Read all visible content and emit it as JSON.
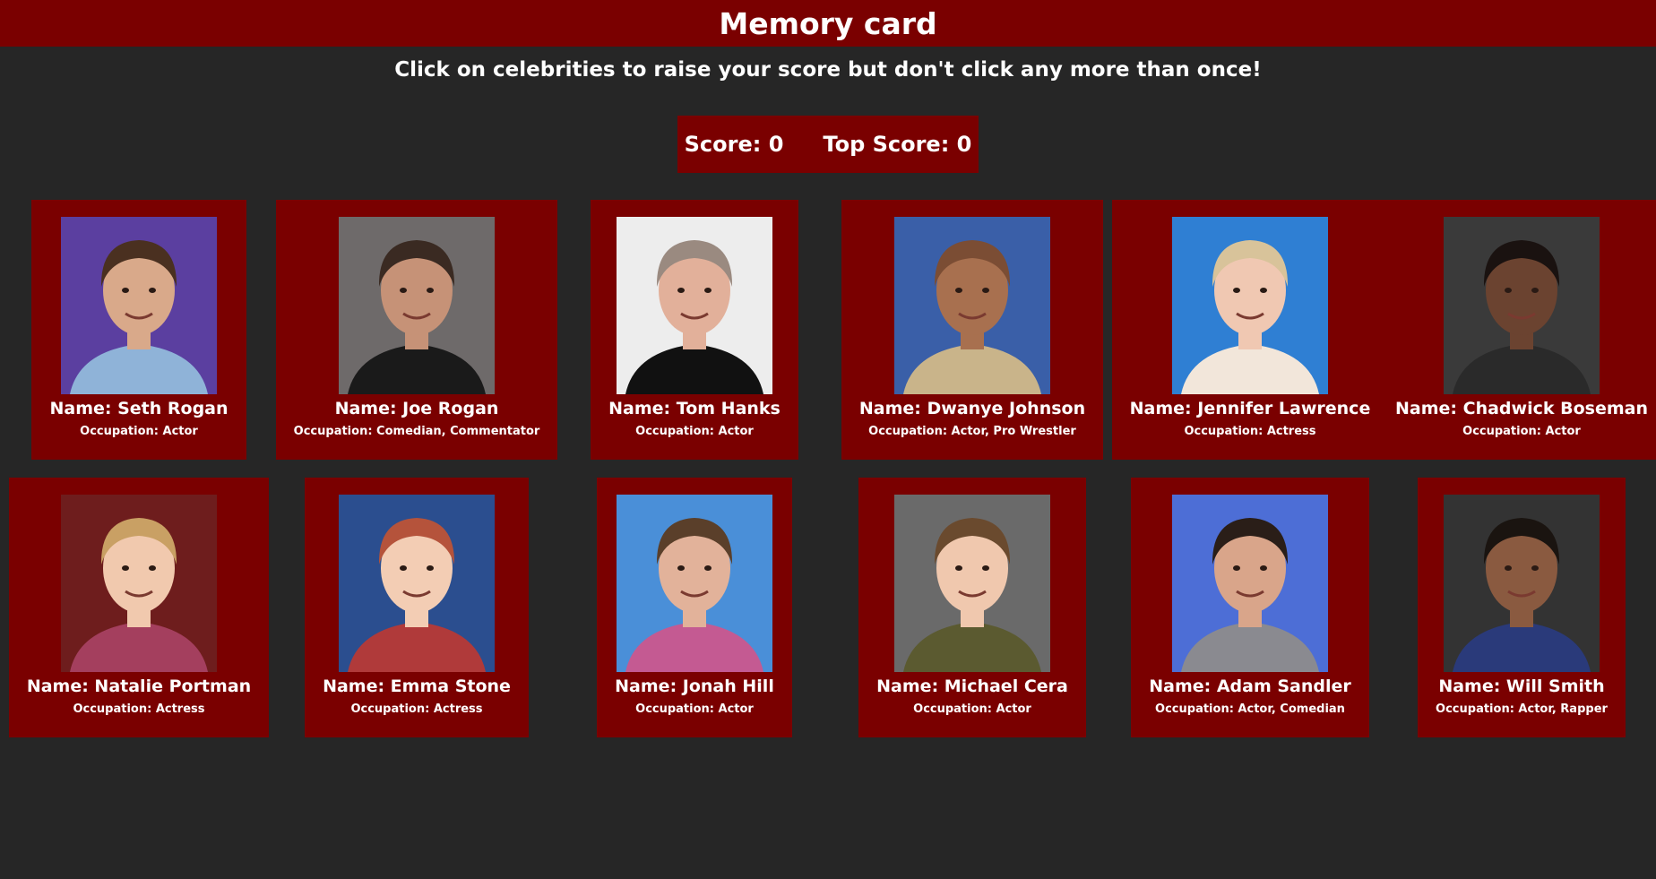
{
  "header": {
    "title": "Memory card"
  },
  "subtitle": "Click on celebrities to raise your score but don't click any more than once!",
  "score": {
    "current": "Score: 0",
    "top": "Top Score: 0",
    "current_value": 0,
    "top_value": 0
  },
  "colors": {
    "background": "#262626",
    "accent": "#7a0000",
    "text": "#ffffff"
  },
  "cards": [
    {
      "name": "Name: Seth Rogan",
      "occupation": "Occupation: Actor",
      "bg": "#5b3fa0",
      "skin": "#d9a98a",
      "hair": "#4a3020",
      "cloth": "#8fb3d8"
    },
    {
      "name": "Name: Joe Rogan",
      "occupation": "Occupation: Comedian, Commentator",
      "bg": "#6e6a6a",
      "skin": "#c69277",
      "hair": "#3a2a22",
      "cloth": "#1a1a1a"
    },
    {
      "name": "Name: Tom Hanks",
      "occupation": "Occupation: Actor",
      "bg": "#ededed",
      "skin": "#e2b09a",
      "hair": "#9a8a80",
      "cloth": "#111111"
    },
    {
      "name": "Name: Dwanye Johnson",
      "occupation": "Occupation: Actor, Pro Wrestler",
      "bg": "#3a5fa8",
      "skin": "#a8704f",
      "hair": "#7b4d34",
      "cloth": "#c9b48a"
    },
    {
      "name": "Name: Jennifer Lawrence",
      "occupation": "Occupation: Actress",
      "bg": "#2f7fd3",
      "skin": "#f0c8b2",
      "hair": "#d8c39a",
      "cloth": "#f2e6da"
    },
    {
      "name": "Name: Chadwick Boseman",
      "occupation": "Occupation: Actor",
      "bg": "#3a3a3a",
      "skin": "#6b4330",
      "hair": "#1a1210",
      "cloth": "#2a2a2a"
    },
    {
      "name": "Name: Natalie Portman",
      "occupation": "Occupation: Actress",
      "bg": "#6e1d1d",
      "skin": "#f1c9ae",
      "hair": "#c9a064",
      "cloth": "#a43f5e"
    },
    {
      "name": "Name: Emma Stone",
      "occupation": "Occupation: Actress",
      "bg": "#2b4e8f",
      "skin": "#f3cdb4",
      "hair": "#b5533b",
      "cloth": "#b03a3a"
    },
    {
      "name": "Name: Jonah Hill",
      "occupation": "Occupation: Actor",
      "bg": "#4a8fd8",
      "skin": "#e2b29a",
      "hair": "#5a3f2a",
      "cloth": "#c45a92"
    },
    {
      "name": "Name: Michael Cera",
      "occupation": "Occupation: Actor",
      "bg": "#6a6a6a",
      "skin": "#f0c8ae",
      "hair": "#6a4a2e",
      "cloth": "#5b5a30"
    },
    {
      "name": "Name: Adam Sandler",
      "occupation": "Occupation: Actor, Comedian",
      "bg": "#4d6ed6",
      "skin": "#d9a58a",
      "hair": "#2a1e18",
      "cloth": "#8a8a90"
    },
    {
      "name": "Name: Will Smith",
      "occupation": "Occupation: Actor, Rapper",
      "bg": "#333333",
      "skin": "#8a5a40",
      "hair": "#1a1410",
      "cloth": "#2a3a7a"
    }
  ]
}
